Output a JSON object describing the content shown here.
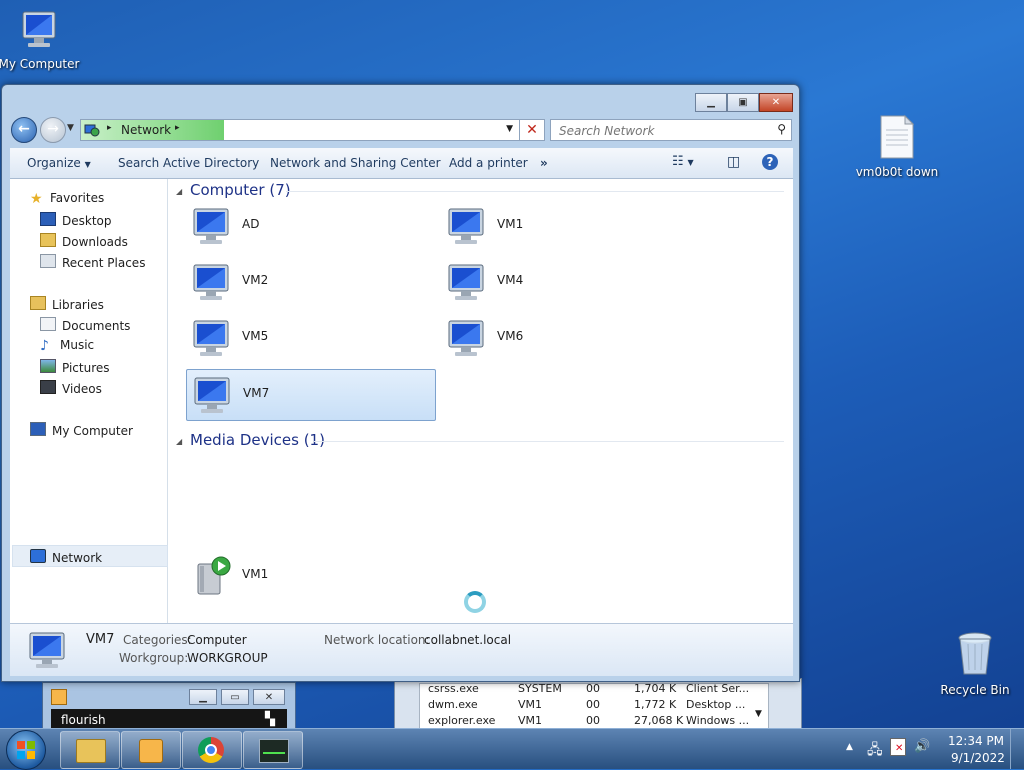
{
  "desktop": {
    "icons": {
      "my_computer": "My Computer",
      "vm_file": "vm0b0t down",
      "recycle_bin": "Recycle Bin"
    }
  },
  "explorer": {
    "address": {
      "segments": [
        "Network"
      ]
    },
    "search_placeholder": "Search Network",
    "toolbar": {
      "organize": "Organize",
      "search_ad": "Search Active Directory",
      "network_sharing": "Network and Sharing Center",
      "add_printer": "Add a printer",
      "more": "»"
    },
    "nav": {
      "favorites": "Favorites",
      "desktop": "Desktop",
      "downloads": "Downloads",
      "recent_places": "Recent Places",
      "libraries": "Libraries",
      "documents": "Documents",
      "music": "Music",
      "pictures": "Pictures",
      "videos": "Videos",
      "my_computer": "My Computer",
      "network": "Network"
    },
    "groups": {
      "computer": "Computer (7)",
      "media": "Media Devices (1)"
    },
    "computers": [
      "AD",
      "VM1",
      "VM2",
      "VM4",
      "VM5",
      "VM6",
      "VM7"
    ],
    "media_devices": [
      "VM1"
    ],
    "selected": "VM7",
    "details": {
      "name": "VM7",
      "categories_label": "Categories:",
      "categories_value": "Computer",
      "workgroup_label": "Workgroup:",
      "workgroup_value": "WORKGROUP",
      "location_label": "Network location:",
      "location_value": "collabnet.local"
    }
  },
  "bg_window_1": {
    "title": "flourish"
  },
  "task_manager": {
    "rows": [
      {
        "name": "csrss.exe",
        "user": "SYSTEM",
        "cpu": "00",
        "mem": "1,704 K",
        "desc": "Client Ser..."
      },
      {
        "name": "dwm.exe",
        "user": "VM1",
        "cpu": "00",
        "mem": "1,772 K",
        "desc": "Desktop ..."
      },
      {
        "name": "explorer.exe",
        "user": "VM1",
        "cpu": "00",
        "mem": "27,068 K",
        "desc": "Windows ..."
      }
    ]
  },
  "taskbar": {
    "clock_time": "12:34 PM",
    "clock_date": "9/1/2022",
    "show_hidden": "▲"
  },
  "colors": {
    "accent": "#1e3287",
    "selection": "#c8dff7",
    "desktop": "#2a78d3"
  }
}
